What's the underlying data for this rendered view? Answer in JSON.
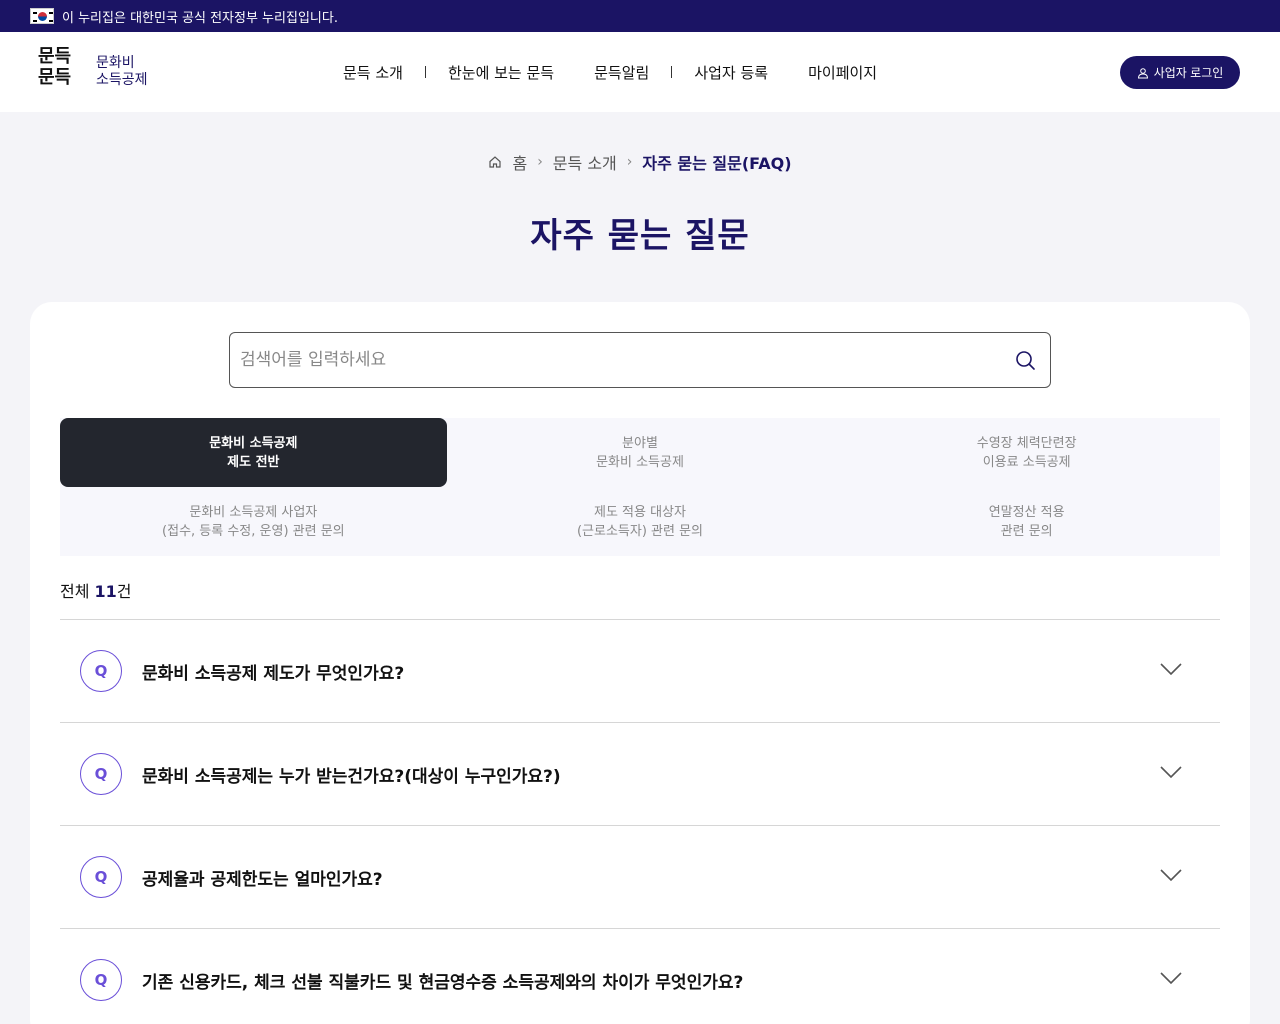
{
  "gov_banner": {
    "text": "이 누리집은 대한민국 공식 전자정부 누리집입니다."
  },
  "logo": {
    "mark_line1": "문득",
    "mark_line2": "문득",
    "text_line1": "문화비",
    "text_line2": "소득공제"
  },
  "nav": {
    "items": [
      "문득 소개",
      "한눈에 보는 문득",
      "문득알림",
      "사업자 등록",
      "마이페이지"
    ]
  },
  "login": {
    "label": "사업자 로그인"
  },
  "breadcrumb": {
    "home": "홈",
    "level1": "문득 소개",
    "current": "자주 묻는 질문(FAQ)"
  },
  "page": {
    "title": "자주 묻는 질문"
  },
  "search": {
    "placeholder": "검색어를 입력하세요"
  },
  "tabs": [
    {
      "label": "문화비 소득공제\n제도 전반",
      "active": true
    },
    {
      "label": "분야별\n문화비 소득공제",
      "active": false
    },
    {
      "label": "수영장 체력단련장\n이용료 소득공제",
      "active": false
    },
    {
      "label": "문화비 소득공제 사업자\n(접수, 등록 수정, 운영) 관련 문의",
      "active": false
    },
    {
      "label": "제도 적용 대상자\n(근로소득자) 관련 문의",
      "active": false
    },
    {
      "label": "연말정산 적용\n관련 문의",
      "active": false
    }
  ],
  "total": {
    "prefix": "전체 ",
    "count": "11",
    "suffix": "건"
  },
  "faq": {
    "badge": "Q",
    "items": [
      "문화비 소득공제 제도가 무엇인가요?",
      "문화비 소득공제는 누가 받는건가요?(대상이 누구인가요?)",
      "공제율과 공제한도는 얼마인가요?",
      "기존 신용카드, 체크 선불 직불카드 및 현금영수증 소득공제와의 차이가 무엇인가요?"
    ]
  },
  "colors": {
    "primary": "#1b1464",
    "accent": "#6a4fd8",
    "tab_active": "#23262e"
  }
}
